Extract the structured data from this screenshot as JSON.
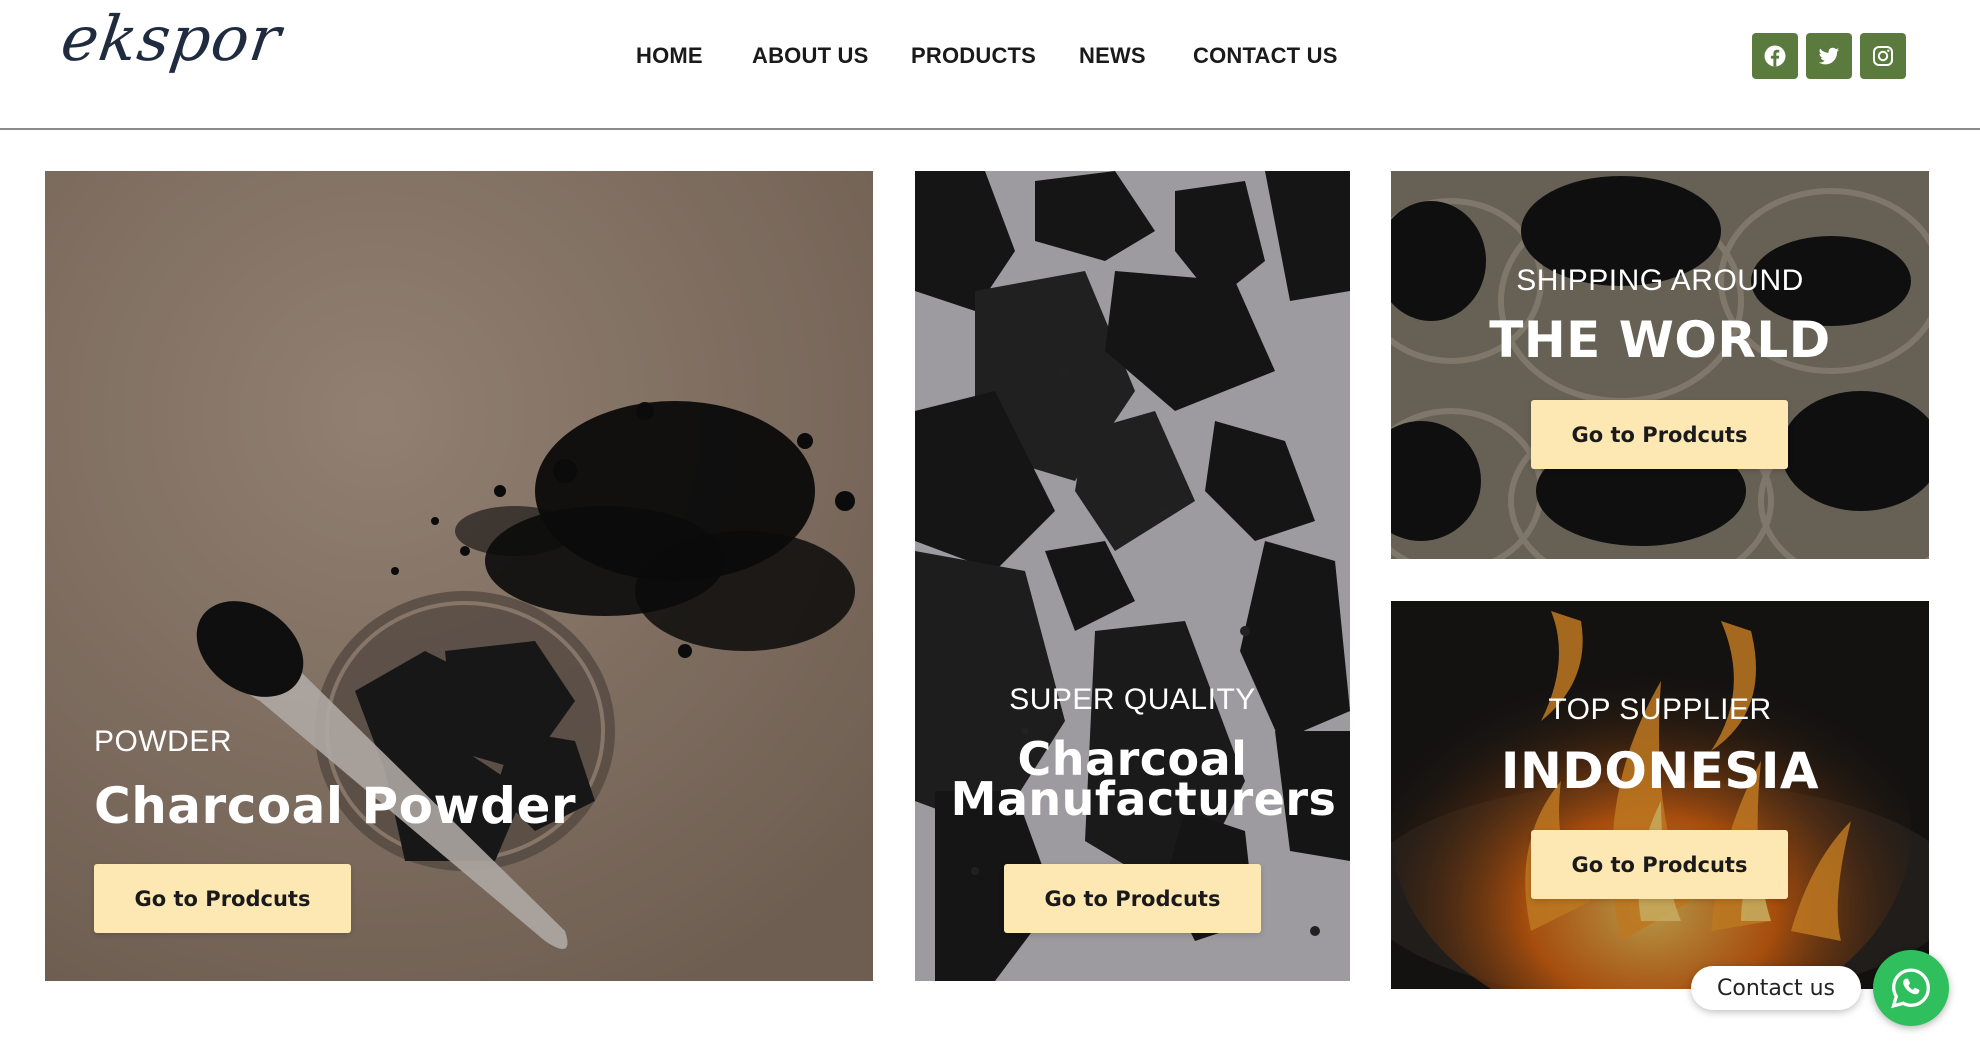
{
  "header": {
    "logo_text": "ekspor",
    "nav": [
      {
        "label": "HOME"
      },
      {
        "label": "ABOUT US"
      },
      {
        "label": "PRODUCTS"
      },
      {
        "label": "NEWS"
      },
      {
        "label": "CONTACT US"
      }
    ],
    "social": [
      {
        "icon": "facebook-icon"
      },
      {
        "icon": "twitter-icon"
      },
      {
        "icon": "instagram-icon"
      }
    ]
  },
  "colors": {
    "social_bg": "#5a7a3e",
    "cta_bg": "#fde8b4",
    "whatsapp": "#2fbf5c"
  },
  "cards": [
    {
      "kicker": "POWDER",
      "title": "Charcoal Powder",
      "button": "Go to Prodcuts"
    },
    {
      "kicker": "SUPER QUALITY",
      "title_line1": "Charcoal",
      "title_line2": "Manufacturers",
      "button": "Go to Prodcuts"
    },
    {
      "kicker": "SHIPPING AROUND",
      "title": "THE WORLD",
      "button": "Go to Prodcuts"
    },
    {
      "kicker": "TOP SUPPLIER",
      "title": "INDONESIA",
      "button": "Go to Prodcuts"
    }
  ],
  "whatsapp": {
    "label": "Contact us",
    "icon": "whatsapp-icon"
  }
}
